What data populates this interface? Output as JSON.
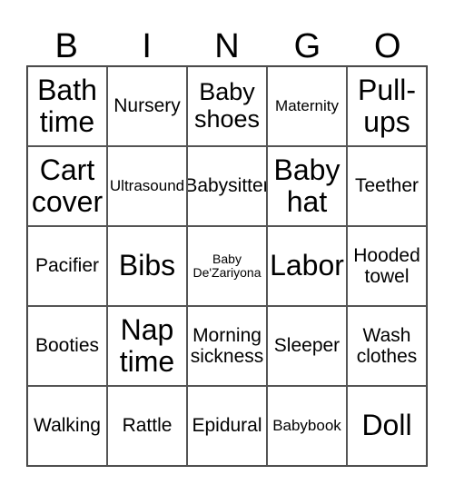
{
  "header": [
    "B",
    "I",
    "N",
    "G",
    "O"
  ],
  "cells": [
    "Bath time",
    "Nursery",
    "Baby shoes",
    "Maternity",
    "Pull-ups",
    "Cart cover",
    "Ultrasound",
    "Babysitter",
    "Baby hat",
    "Teether",
    "Pacifier",
    "Bibs",
    "Baby De'Zariyona",
    "Labor",
    "Hooded towel",
    "Booties",
    "Nap time",
    "Morning sickness",
    "Sleeper",
    "Wash clothes",
    "Walking",
    "Rattle",
    "Epidural",
    "Babybook",
    "Doll"
  ]
}
